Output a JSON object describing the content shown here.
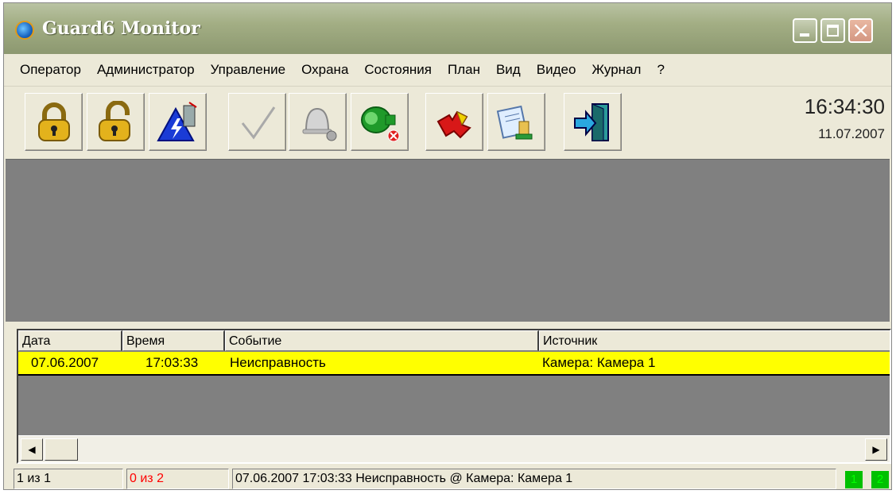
{
  "window": {
    "title": "Guard6 Monitor",
    "close_glyph": "×"
  },
  "menu": [
    "Оператор",
    "Администратор",
    "Управление",
    "Охрана",
    "Состояния",
    "План",
    "Вид",
    "Видео",
    "Журнал",
    "?"
  ],
  "toolbar": {
    "buttons": [
      {
        "icon": "locked-padlock-icon"
      },
      {
        "icon": "unlocked-padlock-icon"
      },
      {
        "icon": "power-alarm-icon"
      },
      {
        "icon": "checkmark-icon",
        "disabled": true
      },
      {
        "icon": "bell-icon",
        "disabled": true
      },
      {
        "icon": "siren-icon"
      },
      {
        "icon": "puzzle-icon"
      },
      {
        "icon": "document-stamp-icon"
      },
      {
        "icon": "exit-door-icon"
      }
    ],
    "clock_time": "16:34:30",
    "clock_date": "11.07.2007"
  },
  "events": {
    "columns": [
      "Дата",
      "Время",
      "Событие",
      "Источник"
    ],
    "rows": [
      {
        "date": "07.06.2007",
        "time": "17:03:33",
        "event": "Неисправность",
        "source": "Камера: Камера 1",
        "highlight": "#ffff00"
      }
    ],
    "scroll_left": "◀",
    "scroll_right": "▶"
  },
  "status": {
    "count": "1 из 1",
    "alarm_count": "0 из 2",
    "alarm_color": "#ff0000",
    "message": "07.06.2007 17:03:33 Неисправность  @ Камера: Камера 1",
    "indicators": [
      "1",
      "2"
    ],
    "indicator_color": "#00c000"
  }
}
